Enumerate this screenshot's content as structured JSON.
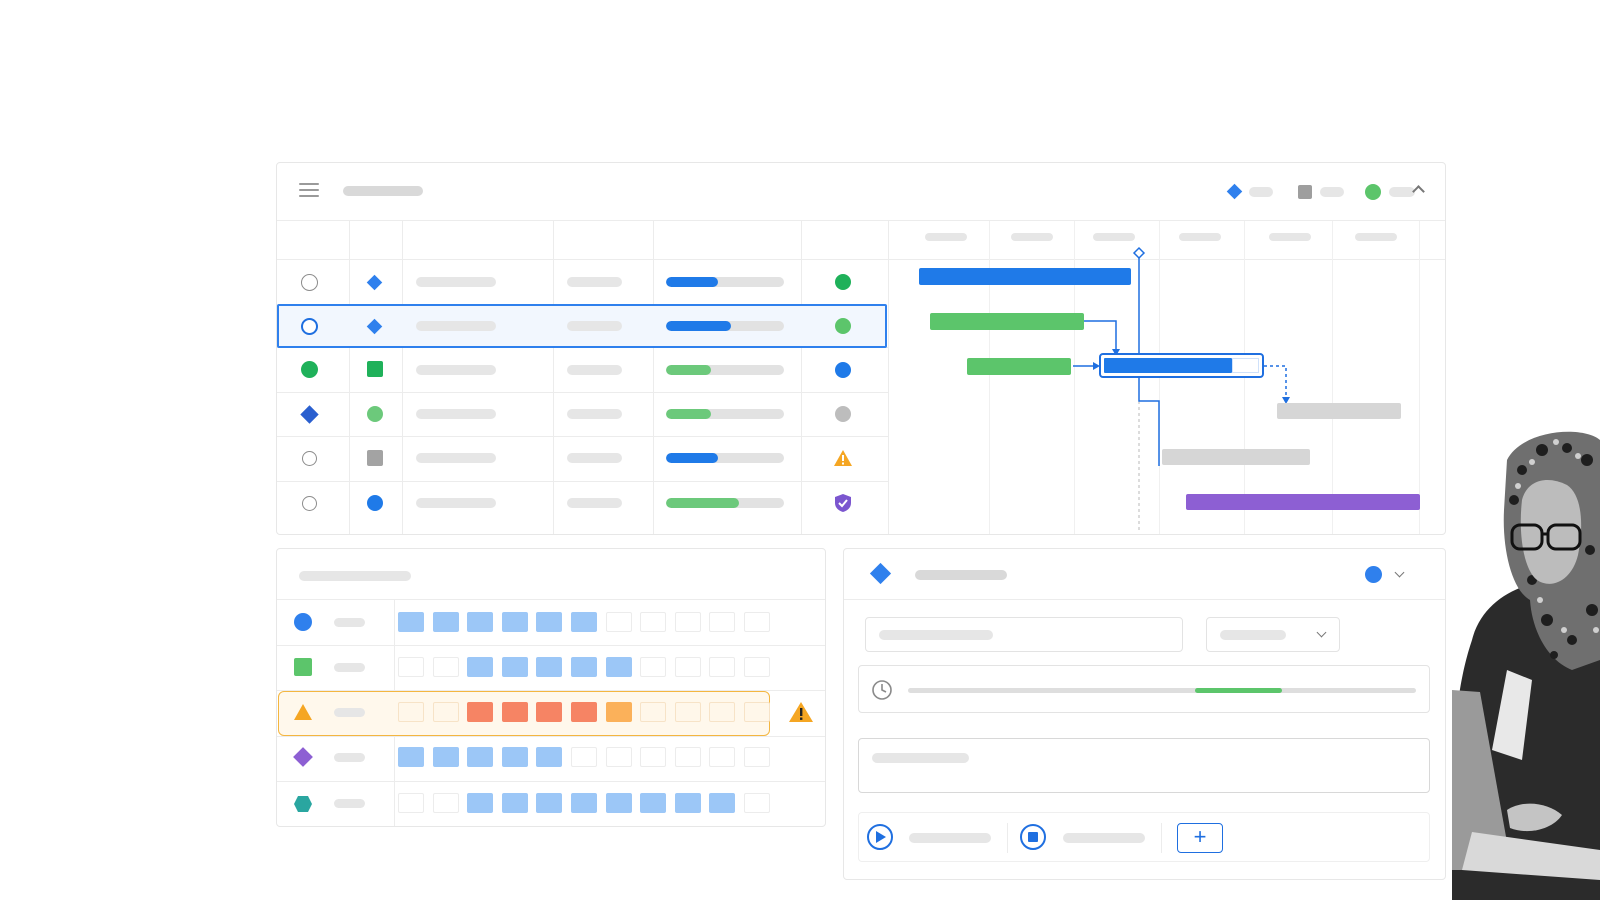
{
  "header": {
    "legend": [
      {
        "icon": "diamond-icon",
        "color": "#2f80ed"
      },
      {
        "icon": "square-icon",
        "color": "#9e9e9e"
      },
      {
        "icon": "circle-icon",
        "color": "#5cc56b"
      }
    ]
  },
  "colors": {
    "blue": "#2f80ed",
    "green": "#5cc56b",
    "gray": "#d4d4d4",
    "purple": "#8d5fd3",
    "warning": "#f5a623",
    "selected_border": "#2f80ed"
  },
  "task_rows": [
    {
      "status_icon": "empty-circle-icon",
      "type_icon": "blue-diamond-icon",
      "progress": 0.44,
      "progress_color": "#1f7ae8",
      "state_icon": "green-dot-icon"
    },
    {
      "status_icon": "selected-circle-icon",
      "type_icon": "blue-diamond-icon",
      "progress": 0.55,
      "progress_color": "#1f7ae8",
      "state_icon": "light-green-dot-icon",
      "selected": true
    },
    {
      "status_icon": "green-dot-icon",
      "type_icon": "green-square-icon",
      "progress": 0.38,
      "progress_color": "#6cc97b",
      "state_icon": "blue-dot-icon"
    },
    {
      "status_icon": "blue-diamond-icon",
      "type_icon": "green-dot-icon",
      "progress": 0.38,
      "progress_color": "#6cc97b",
      "state_icon": "gray-dot-icon"
    },
    {
      "status_icon": "empty-circle-icon",
      "type_icon": "gray-square-icon",
      "progress": 0.44,
      "progress_color": "#1f7ae8",
      "state_icon": "warning-icon"
    },
    {
      "status_icon": "empty-circle-icon",
      "type_icon": "blue-dot-icon",
      "progress": 0.62,
      "progress_color": "#6cc97b",
      "state_icon": "shield-check-icon"
    }
  ],
  "resource_rows": [
    {
      "icon": "blue-circle-icon",
      "cells": [
        "blue",
        "blue",
        "blue",
        "blue",
        "blue",
        "blue",
        "empty",
        "empty",
        "empty",
        "empty",
        "empty"
      ]
    },
    {
      "icon": "green-square-icon",
      "cells": [
        "empty",
        "empty",
        "blue",
        "blue",
        "blue",
        "blue",
        "blue",
        "empty",
        "empty",
        "empty",
        "empty"
      ]
    },
    {
      "icon": "orange-triangle-icon",
      "cells": [
        "faint",
        "faint",
        "red",
        "red",
        "red",
        "red",
        "orange",
        "faint",
        "faint",
        "faint",
        "faint"
      ],
      "warning": true
    },
    {
      "icon": "purple-diamond-icon",
      "cells": [
        "blue",
        "blue",
        "blue",
        "blue",
        "blue",
        "empty",
        "empty",
        "empty",
        "empty",
        "empty",
        "empty"
      ]
    },
    {
      "icon": "teal-hexagon-icon",
      "cells": [
        "empty",
        "empty",
        "blue",
        "blue",
        "blue",
        "blue",
        "blue",
        "blue",
        "blue",
        "blue",
        "empty"
      ]
    }
  ],
  "detail": {
    "timeline_progress": 0.17,
    "icons": [
      "blue-diamond-icon",
      "blue-dot-icon",
      "chevron-down-icon",
      "clock-icon",
      "play-icon",
      "stop-icon",
      "plus-icon"
    ],
    "plus_label": "+"
  }
}
